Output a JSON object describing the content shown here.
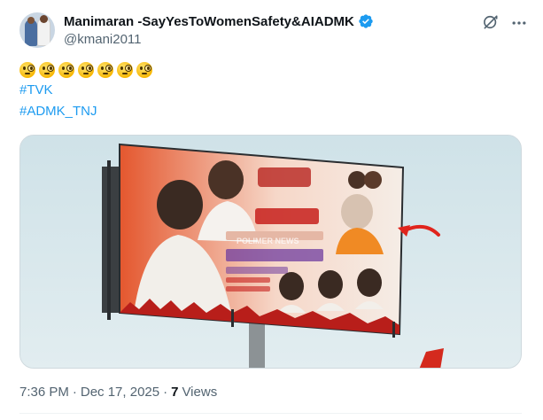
{
  "tweet": {
    "display_name": "Manimaran -SayYesToWomenSafety&AIADMK",
    "handle": "@kmani2011",
    "verified": true,
    "emoji_line": [
      "face-with-monocle",
      "face-with-monocle",
      "face-with-monocle",
      "face-with-monocle",
      "face-with-monocle",
      "face-with-monocle",
      "face-with-monocle"
    ],
    "hashtags": [
      "#TVK",
      "#ADMK_TNJ"
    ],
    "image_watermark": "POLIMER NEWS",
    "time": "7:36 PM",
    "separator": "·",
    "date": "Dec 17, 2025",
    "views_count": "7",
    "views_label": "Views"
  },
  "icons": {
    "verified": "verified-badge-icon",
    "grok": "grok-icon",
    "more": "more-options-icon",
    "arrow": "red-arrow-annotation"
  },
  "colors": {
    "accent": "#1d9bf0",
    "text_primary": "#0f1419",
    "text_secondary": "#536471",
    "arrow_red": "#e0241c",
    "billboard_orange": "#e4572e"
  }
}
